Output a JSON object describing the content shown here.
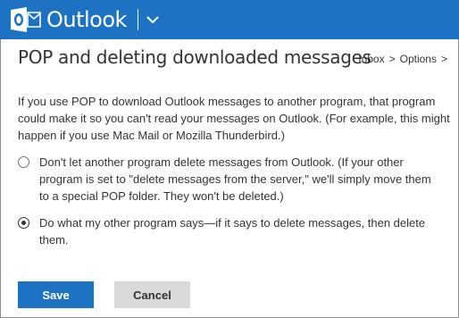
{
  "header": {
    "logo_text": "Outlook",
    "logo_icon": "outlook-logo-icon",
    "menu_icon": "chevron-down-icon",
    "bg_color": "#1e72c3"
  },
  "page": {
    "title": "POP and deleting downloaded messages",
    "breadcrumb": {
      "inbox": "Inbox",
      "separator": ">",
      "options": "Options",
      "trailing": ">"
    }
  },
  "content": {
    "intro": "If you use POP to download Outlook messages to another program, that program could make it so you can't read your messages on Outlook. (For example, this might happen if you use Mac Mail or Mozilla Thunderbird.)",
    "options": [
      {
        "label": "Don't let another program delete messages from Outlook. (If your other program is set to \"delete messages from the server,\" we'll simply move them to a special POP folder. They won't be deleted.)",
        "selected": false
      },
      {
        "label": "Do what my other program says—if it says to delete messages, then delete them.",
        "selected": true
      }
    ]
  },
  "actions": {
    "save_label": "Save",
    "cancel_label": "Cancel",
    "save_color": "#1e72c3",
    "cancel_color": "#d9d9d9"
  }
}
